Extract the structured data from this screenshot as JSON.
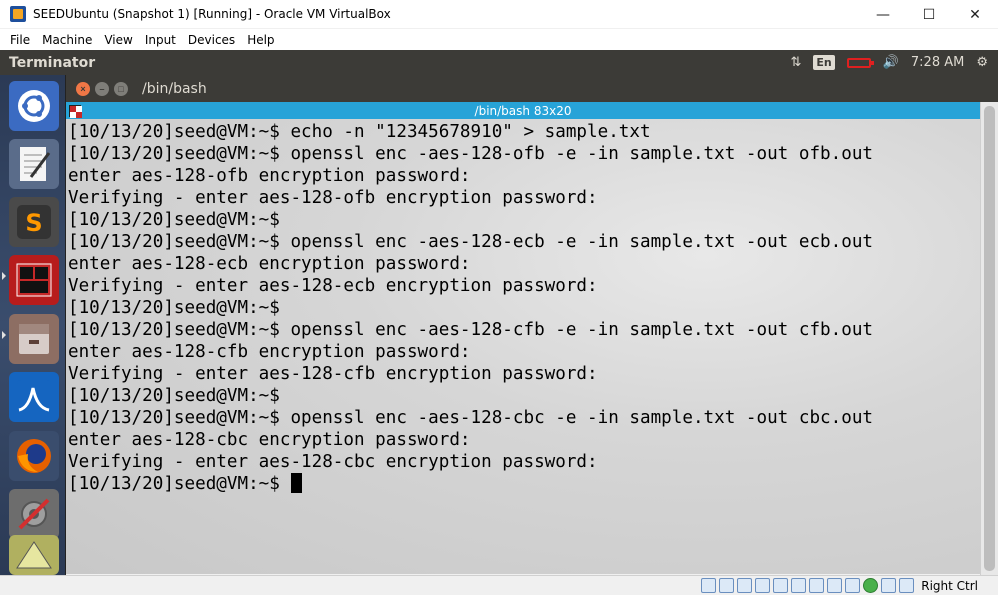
{
  "host_window": {
    "title": "SEEDUbuntu (Snapshot 1) [Running] - Oracle VM VirtualBox",
    "controls": {
      "minimize": "—",
      "maximize": "☐",
      "close": "✕"
    }
  },
  "menu": {
    "items": [
      "File",
      "Machine",
      "View",
      "Input",
      "Devices",
      "Help"
    ]
  },
  "ubuntu_panel": {
    "app_name": "Terminator",
    "keyboard_lang": "En",
    "time": "7:28 AM"
  },
  "launcher": {
    "items": [
      "ubuntu-dash",
      "text-editor",
      "sublime-text",
      "terminator",
      "file-manager",
      "wireshark",
      "firefox",
      "settings"
    ]
  },
  "terminal_window": {
    "title": "/bin/bash",
    "header_title": "/bin/bash 83x20",
    "lines": [
      "[10/13/20]seed@VM:~$ echo -n \"12345678910\" > sample.txt",
      "[10/13/20]seed@VM:~$ openssl enc -aes-128-ofb -e -in sample.txt -out ofb.out",
      "enter aes-128-ofb encryption password:",
      "Verifying - enter aes-128-ofb encryption password:",
      "[10/13/20]seed@VM:~$",
      "[10/13/20]seed@VM:~$ openssl enc -aes-128-ecb -e -in sample.txt -out ecb.out",
      "enter aes-128-ecb encryption password:",
      "Verifying - enter aes-128-ecb encryption password:",
      "[10/13/20]seed@VM:~$",
      "[10/13/20]seed@VM:~$ openssl enc -aes-128-cfb -e -in sample.txt -out cfb.out",
      "enter aes-128-cfb encryption password:",
      "Verifying - enter aes-128-cfb encryption password:",
      "[10/13/20]seed@VM:~$",
      "[10/13/20]seed@VM:~$ openssl enc -aes-128-cbc -e -in sample.txt -out cbc.out",
      "enter aes-128-cbc encryption password:",
      "Verifying - enter aes-128-cbc encryption password:",
      "[10/13/20]seed@VM:~$ "
    ]
  },
  "status_bar": {
    "host_key": "Right Ctrl"
  },
  "colors": {
    "ubuntu_panel": "#3c3b37",
    "terminator_header": "#27a3d8",
    "close_button": "#f07746"
  }
}
